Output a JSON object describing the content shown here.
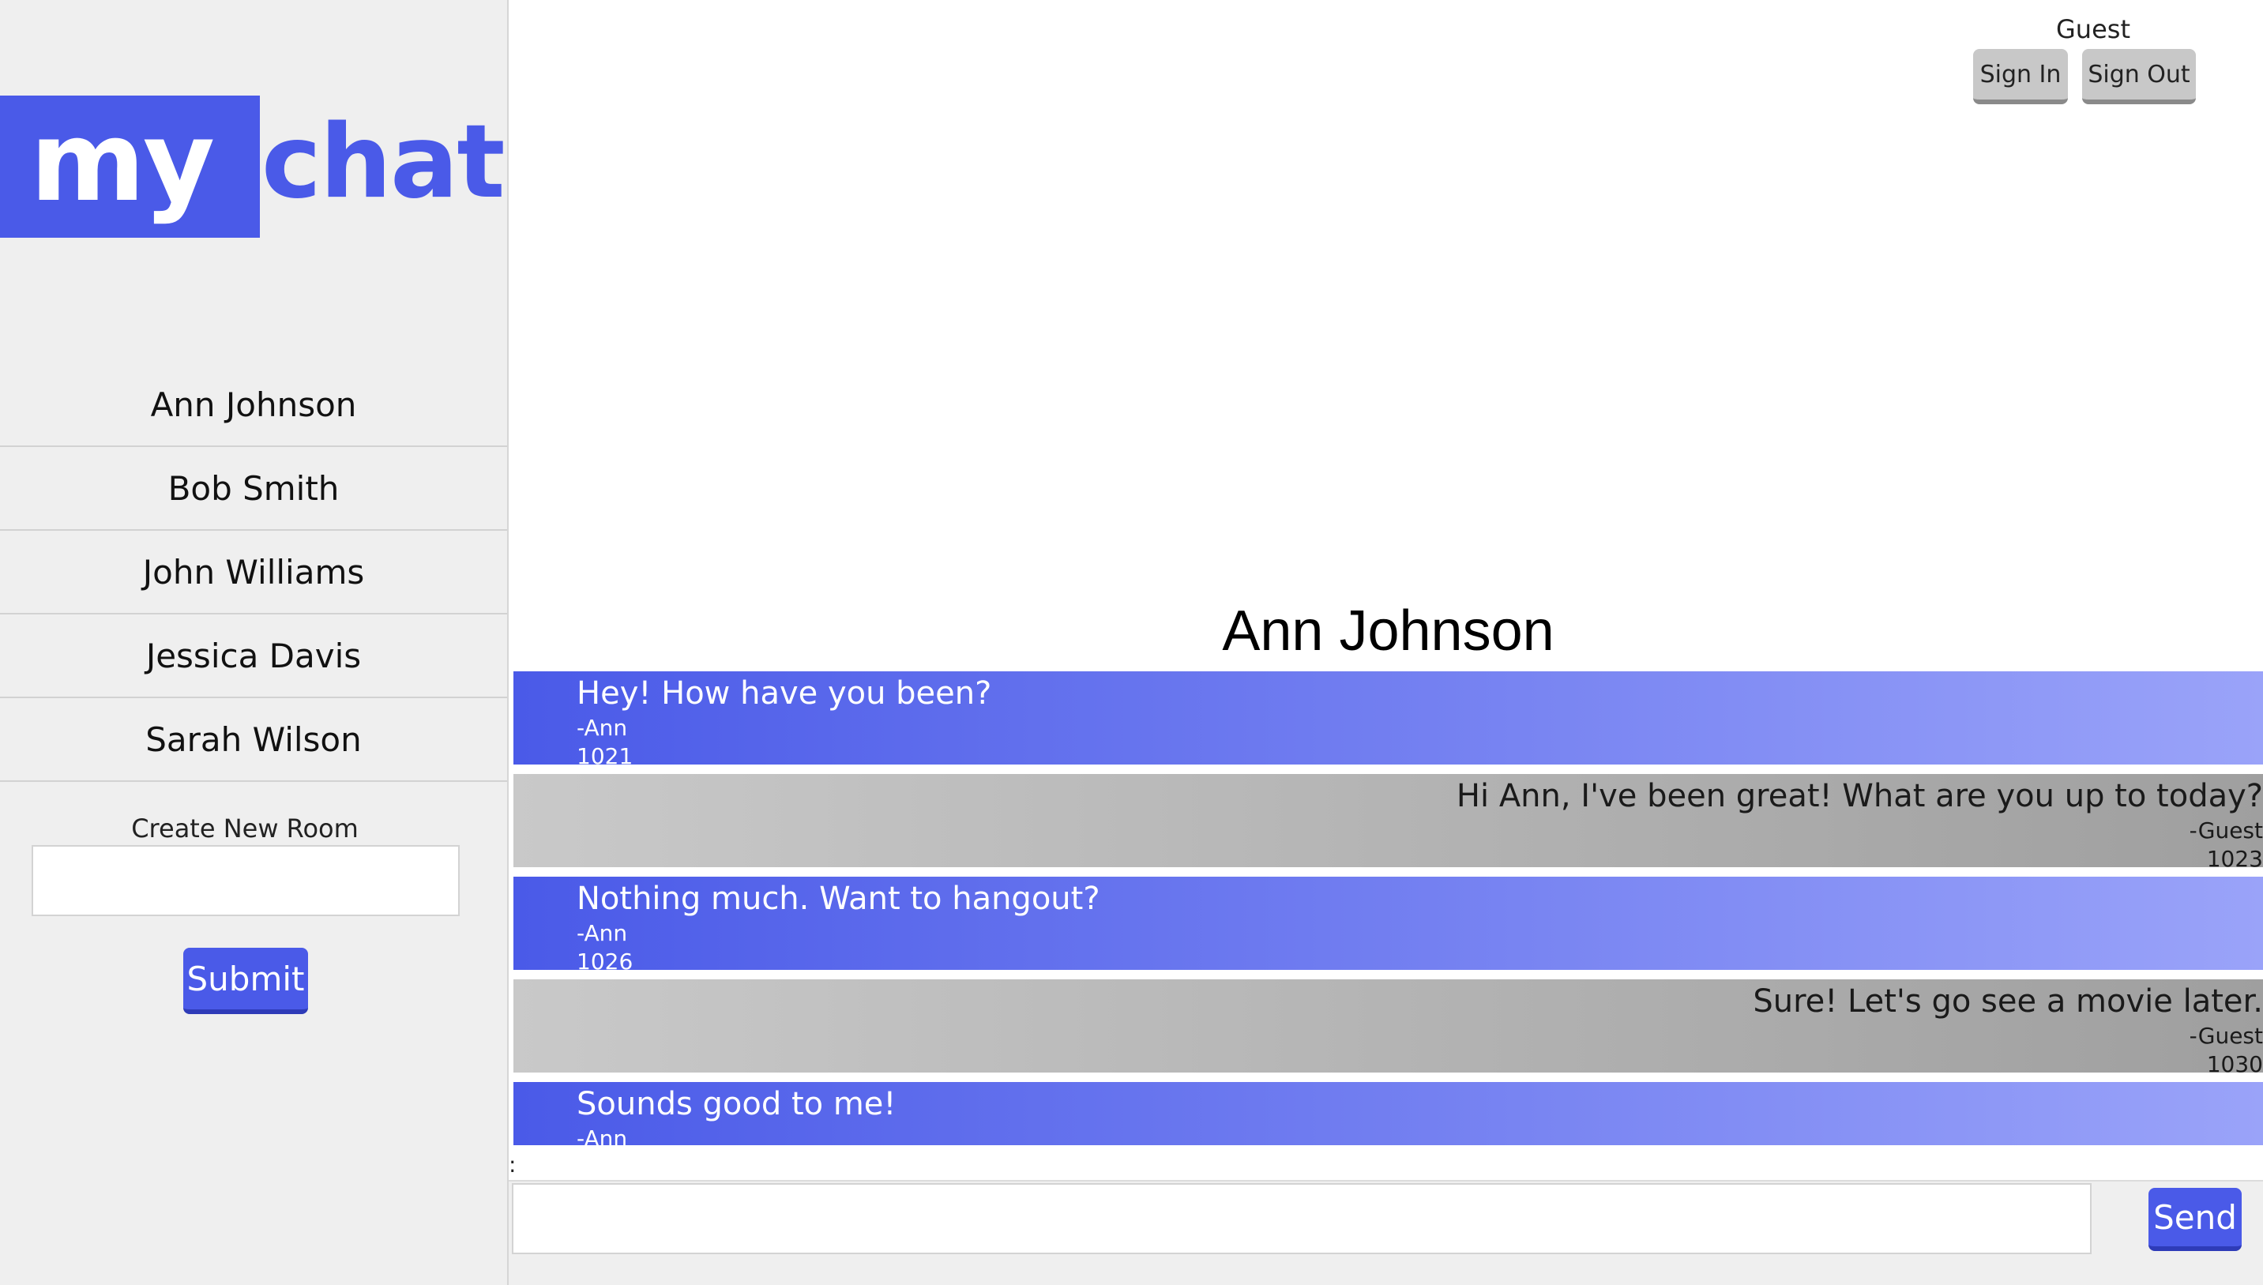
{
  "logo": {
    "part1": "my",
    "part2": "chat"
  },
  "sidebar": {
    "rooms": [
      {
        "label": "Ann Johnson"
      },
      {
        "label": "Bob Smith"
      },
      {
        "label": "John Williams"
      },
      {
        "label": "Jessica Davis"
      },
      {
        "label": "Sarah Wilson"
      }
    ],
    "create_room_label": "Create New Room",
    "create_room_value": "",
    "submit_label": "Submit"
  },
  "header": {
    "user_name": "Guest",
    "sign_in_label": "Sign In",
    "sign_out_label": "Sign Out"
  },
  "chat": {
    "title": "Ann Johnson",
    "messages": [
      {
        "text": "Hey! How have you been?",
        "author": "-Ann",
        "id": "1021",
        "sender": "ann"
      },
      {
        "text": "Hi Ann, I've been great! What are you up to today?",
        "author": "-Guest",
        "id": "1023",
        "sender": "guest"
      },
      {
        "text": "Nothing much. Want to hangout?",
        "author": "-Ann",
        "id": "1026",
        "sender": "ann"
      },
      {
        "text": "Sure! Let's go see a movie later.",
        "author": "-Guest",
        "id": "1030",
        "sender": "guest"
      },
      {
        "text": "Sounds good to me!",
        "author": "-Ann",
        "id": "",
        "sender": "ann"
      }
    ],
    "separator": ":"
  },
  "composer": {
    "message_value": "",
    "send_label": "Send"
  },
  "colors": {
    "accent": "#4a5ae8",
    "ann_gradient_end": "#9aa3f9",
    "guest_gradient_start": "#c9c9c9",
    "guest_gradient_end": "#9f9f9f",
    "sidebar_bg": "#efefef"
  }
}
